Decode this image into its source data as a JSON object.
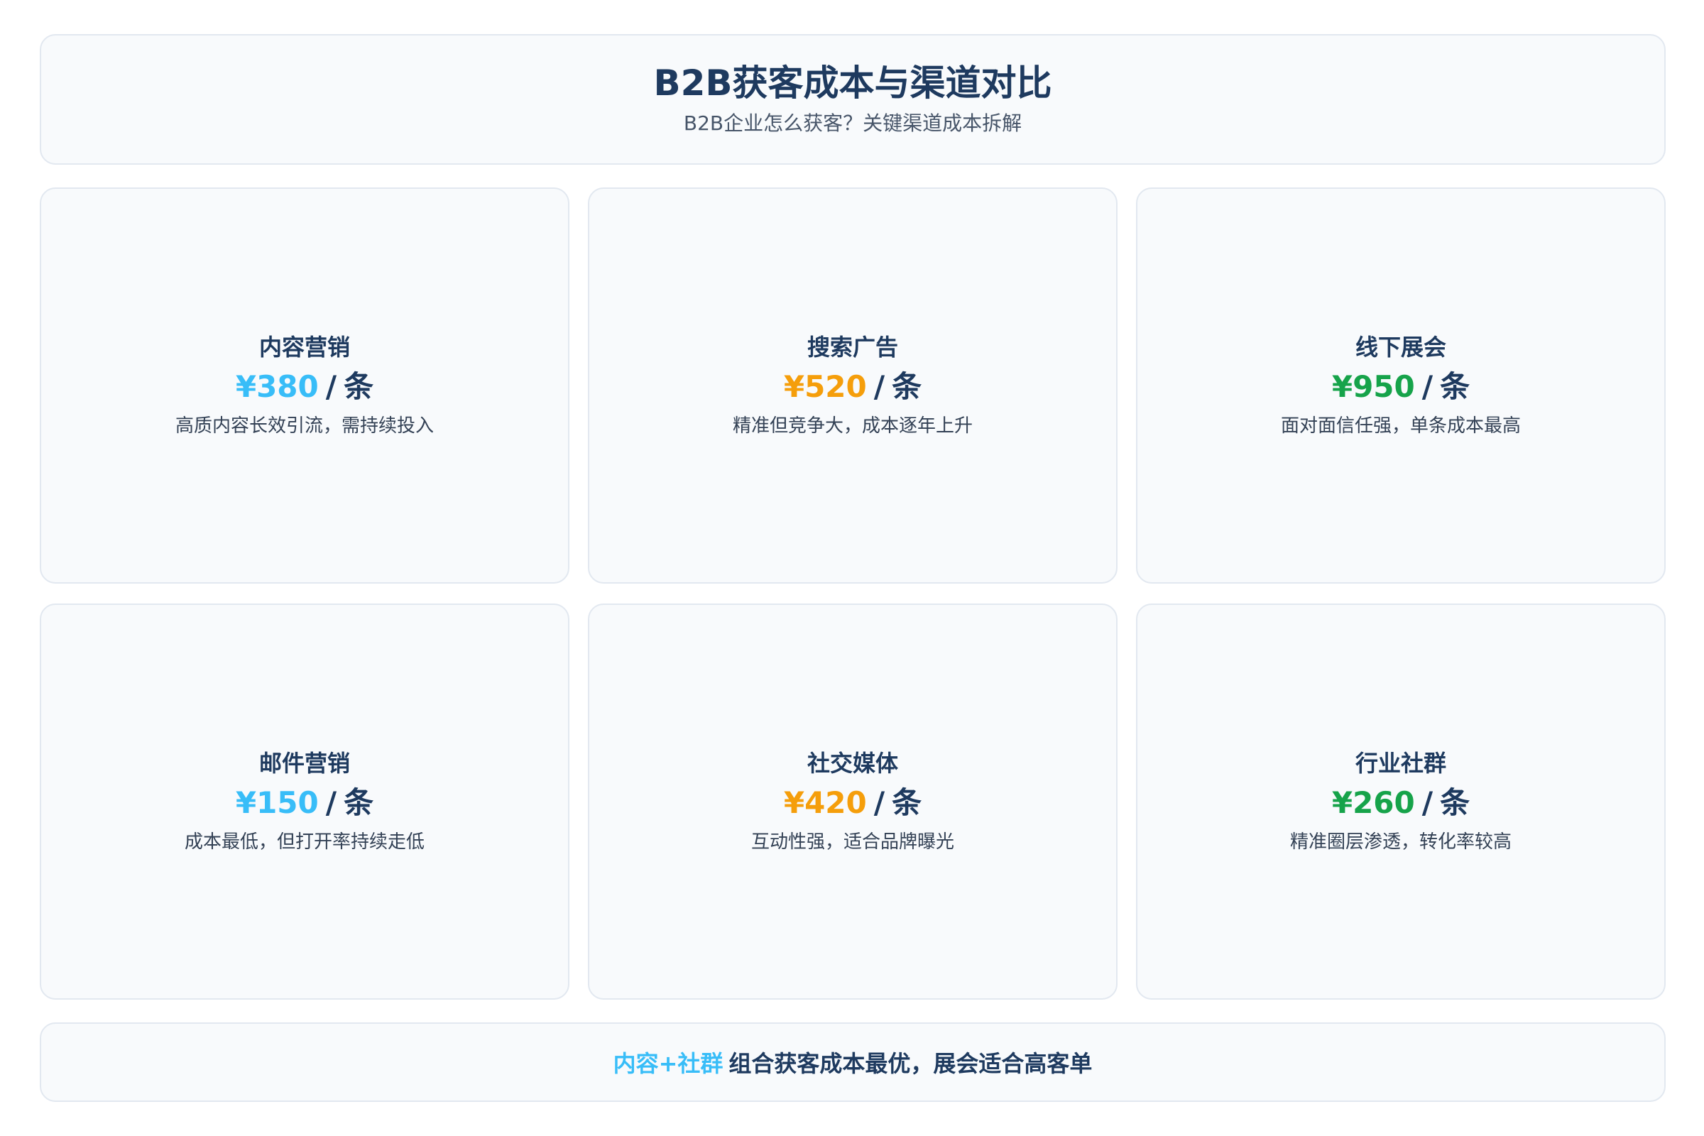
{
  "header": {
    "title": "B2B获客成本与渠道对比",
    "subtitle": "B2B企业怎么获客？关键渠道成本拆解"
  },
  "unit_separator": "/",
  "unit": "条",
  "cards": [
    {
      "title": "内容营销",
      "price": "¥380",
      "desc": "高质内容长效引流，需持续投入",
      "color": "#38bdf8"
    },
    {
      "title": "搜索广告",
      "price": "¥520",
      "desc": "精准但竞争大，成本逐年上升",
      "color": "#f59e0b"
    },
    {
      "title": "线下展会",
      "price": "¥950",
      "desc": "面对面信任强，单条成本最高",
      "color": "#16a34a"
    },
    {
      "title": "邮件营销",
      "price": "¥150",
      "desc": "成本最低，但打开率持续走低",
      "color": "#38bdf8"
    },
    {
      "title": "社交媒体",
      "price": "¥420",
      "desc": "互动性强，适合品牌曝光",
      "color": "#f59e0b"
    },
    {
      "title": "行业社群",
      "price": "¥260",
      "desc": "精准圈层渗透，转化率较高",
      "color": "#16a34a"
    }
  ],
  "footer": {
    "highlight": "内容+社群",
    "text": "组合获客成本最优，展会适合高客单"
  }
}
